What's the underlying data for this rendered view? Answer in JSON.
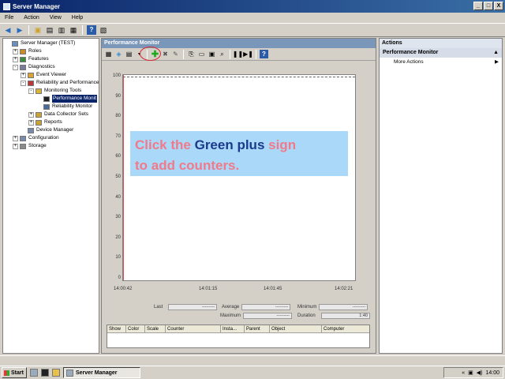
{
  "window": {
    "title": "Server Manager",
    "buttons": [
      "_",
      "□",
      "X"
    ]
  },
  "menu": [
    "File",
    "Action",
    "View",
    "Help"
  ],
  "tree": [
    {
      "label": "Server Manager (TEST)",
      "indent": 0,
      "exp": ""
    },
    {
      "label": "Roles",
      "indent": 1,
      "exp": "+"
    },
    {
      "label": "Features",
      "indent": 1,
      "exp": "+"
    },
    {
      "label": "Diagnostics",
      "indent": 1,
      "exp": "-"
    },
    {
      "label": "Event Viewer",
      "indent": 2,
      "exp": "+"
    },
    {
      "label": "Reliability and Performance",
      "indent": 2,
      "exp": "-"
    },
    {
      "label": "Monitoring Tools",
      "indent": 3,
      "exp": "-"
    },
    {
      "label": "Performance Monit",
      "indent": 4,
      "exp": "",
      "selected": true
    },
    {
      "label": "Reliability Monitor",
      "indent": 4,
      "exp": ""
    },
    {
      "label": "Data Collector Sets",
      "indent": 3,
      "exp": "+"
    },
    {
      "label": "Reports",
      "indent": 3,
      "exp": "+"
    },
    {
      "label": "Device Manager",
      "indent": 2,
      "exp": ""
    },
    {
      "label": "Configuration",
      "indent": 1,
      "exp": "+"
    },
    {
      "label": "Storage",
      "indent": 1,
      "exp": "+"
    }
  ],
  "center": {
    "title": "Performance Monitor",
    "y_ticks": [
      "100",
      "90",
      "80",
      "70",
      "60",
      "50",
      "40",
      "30",
      "20",
      "10",
      "0"
    ],
    "x_ticks": [
      "14:00:42",
      "14:01:15",
      "14:01:45",
      "14:02:21"
    ],
    "banner": {
      "p1": "Click the ",
      "p2": "Green plus",
      "p3": " sign",
      "p4": "to add counters."
    },
    "stats": {
      "last_label": "Last",
      "last_val": "---------",
      "avg_label": "Average",
      "avg_val": "---------",
      "min_label": "Minimum",
      "min_val": "---------",
      "max_label": "Maximum",
      "max_val": "---------",
      "dur_label": "Duration",
      "dur_val": "1:40"
    },
    "columns": [
      "Show",
      "Color",
      "Scale",
      "Counter",
      "Insta...",
      "Parent",
      "Object",
      "Computer"
    ]
  },
  "actions": {
    "title": "Actions",
    "section": "Performance Monitor",
    "items": [
      "More Actions"
    ]
  },
  "taskbar": {
    "start": "Start",
    "task": "Server Manager",
    "clock": "14:00"
  }
}
